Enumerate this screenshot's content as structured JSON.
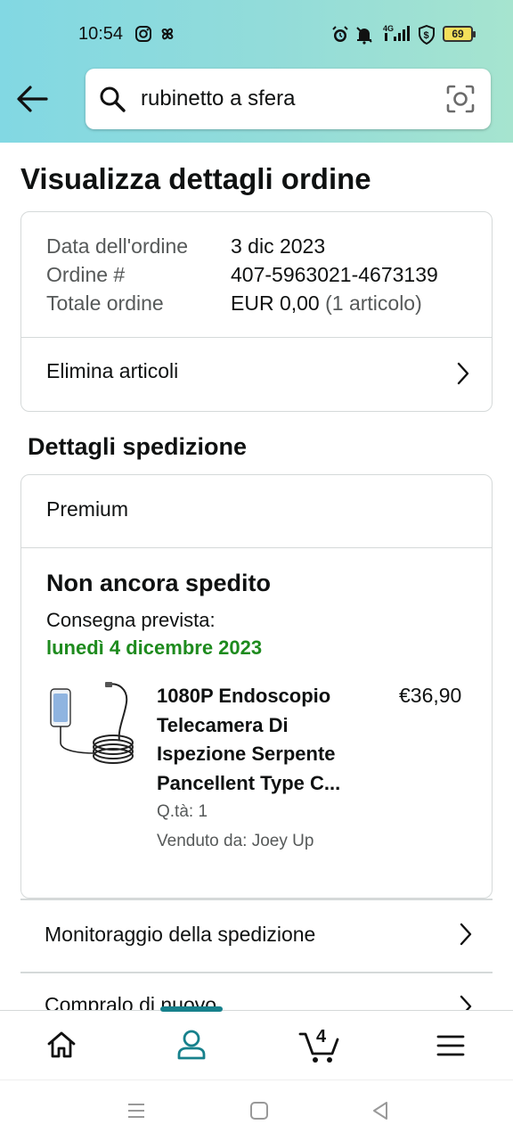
{
  "status_bar": {
    "time": "10:54",
    "battery": "69",
    "network": "4G"
  },
  "search": {
    "query": "rubinetto a sfera"
  },
  "page": {
    "title": "Visualizza dettagli ordine"
  },
  "order_summary": {
    "rows": [
      {
        "label": "Data dell'ordine",
        "value": "3 dic 2023",
        "extra": ""
      },
      {
        "label": "Ordine #",
        "value": "407-5963021-4673139",
        "extra": ""
      },
      {
        "label": "Totale ordine",
        "value": "EUR 0,00",
        "extra": "(1 articolo)"
      }
    ],
    "delete_items": "Elimina articoli"
  },
  "shipping": {
    "heading": "Dettagli spedizione",
    "service": "Premium",
    "status": "Non ancora spedito",
    "eta_label": "Consegna prevista:",
    "eta_date": "lunedì 4 dicembre 2023",
    "item": {
      "title": "1080P Endoscopio Telecamera Di Ispezione Serpente Pancellent Type C...",
      "title_lines": [
        "1080P Endoscopio",
        "Telecamera Di",
        "Ispezione Serpente",
        "Pancellent Type C..."
      ],
      "price": "€36,90",
      "quantity": "Q.tà: 1",
      "seller": "Venduto da: Joey Up"
    }
  },
  "actions": {
    "track": "Monitoraggio della spedizione",
    "buy_again": "Compralo di nuovo"
  },
  "bottom_nav": {
    "cart_count": "4",
    "items": [
      "home-icon",
      "account-icon",
      "cart-icon",
      "menu-icon"
    ],
    "active": "account-icon"
  },
  "colors": {
    "header_gradient_start": "#82d8e3",
    "header_gradient_end": "#a6e4cf",
    "delivery_green": "#1e8b1e",
    "active_teal": "#17818c"
  }
}
